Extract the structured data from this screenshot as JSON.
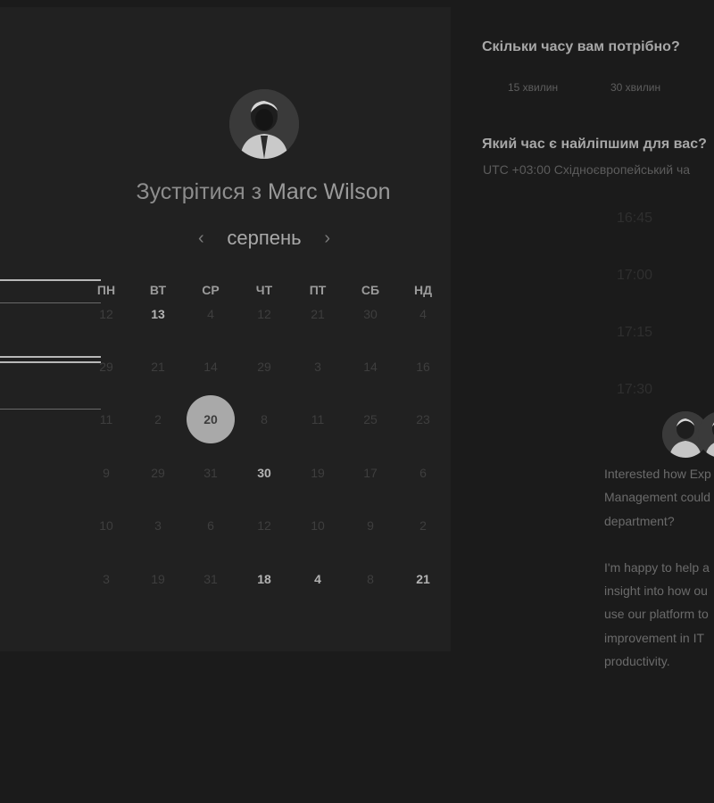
{
  "meeting": {
    "title_prefix": "Зустрітися з",
    "host_name": "Marc Wilson"
  },
  "calendar": {
    "month": "серпень",
    "weekdays": [
      "ПН",
      "ВТ",
      "СР",
      "ЧТ",
      "ПТ",
      "СБ",
      "НД"
    ],
    "rows": [
      [
        "12",
        "13",
        "4",
        "12",
        "21",
        "30",
        "4"
      ],
      [
        "29",
        "21",
        "14",
        "29",
        "3",
        "14",
        "16"
      ],
      [
        "11",
        "2",
        "20",
        "8",
        "11",
        "25",
        "23"
      ],
      [
        "9",
        "29",
        "31",
        "30",
        "19",
        "17",
        "6"
      ],
      [
        "10",
        "3",
        "6",
        "12",
        "10",
        "9",
        "2"
      ],
      [
        "3",
        "19",
        "31",
        "18",
        "4",
        "8",
        "21"
      ]
    ],
    "available": [
      "13",
      "30",
      "18",
      "4",
      "21"
    ],
    "selected": "20"
  },
  "booking": {
    "duration_question": "Скільки часу вам потрібно?",
    "durations": [
      "15 хвилин",
      "30 хвилин"
    ],
    "time_question": "Який час є найліпшим для вас?",
    "timezone": "UTC +03:00 Східноєвропейський ча",
    "slots": [
      "16:45",
      "17:00",
      "17:15",
      "17:30"
    ]
  },
  "about": {
    "paragraph1": [
      "Interested how Exp",
      "Management could",
      "department?"
    ],
    "paragraph2": [
      "I'm happy to help a",
      "insight into how ou",
      "use our platform to",
      "improvement in IT",
      "productivity."
    ]
  },
  "colors": {
    "background": "#1b1b1b",
    "card": "#212121",
    "selected_day": "#a9a9a9"
  }
}
